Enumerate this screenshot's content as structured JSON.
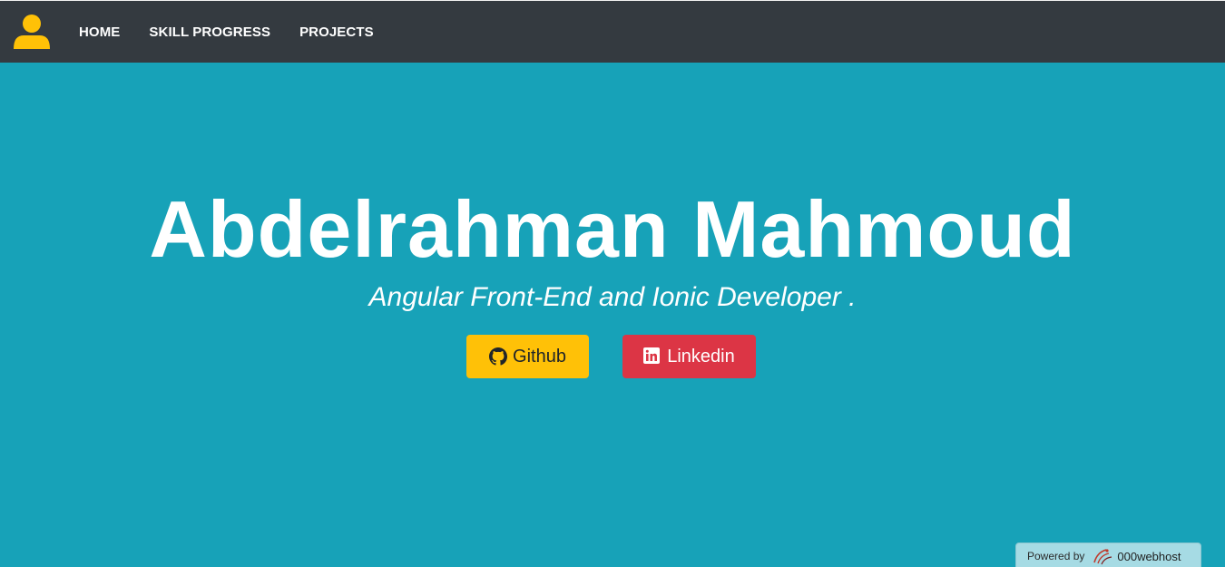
{
  "navbar": {
    "brand_icon": "user-icon",
    "brand_color": "#ffc107",
    "background": "#343a40",
    "links": [
      {
        "label": "HOME"
      },
      {
        "label": "SKILL PROGRESS"
      },
      {
        "label": "PROJECTS"
      }
    ]
  },
  "hero": {
    "background": "#17a2b8",
    "title": "Abdelrahman Mahmoud",
    "subtitle": "Angular Front-End and Ionic Developer ."
  },
  "buttons": {
    "github": {
      "label": "Github",
      "icon": "github-icon",
      "color": "#ffc107"
    },
    "linkedin": {
      "label": "Linkedin",
      "icon": "linkedin-icon",
      "color": "#dc3545"
    }
  },
  "badge": {
    "prefix": "Powered by",
    "brand": "000webhost",
    "icon": "000webhost-logo-icon"
  }
}
